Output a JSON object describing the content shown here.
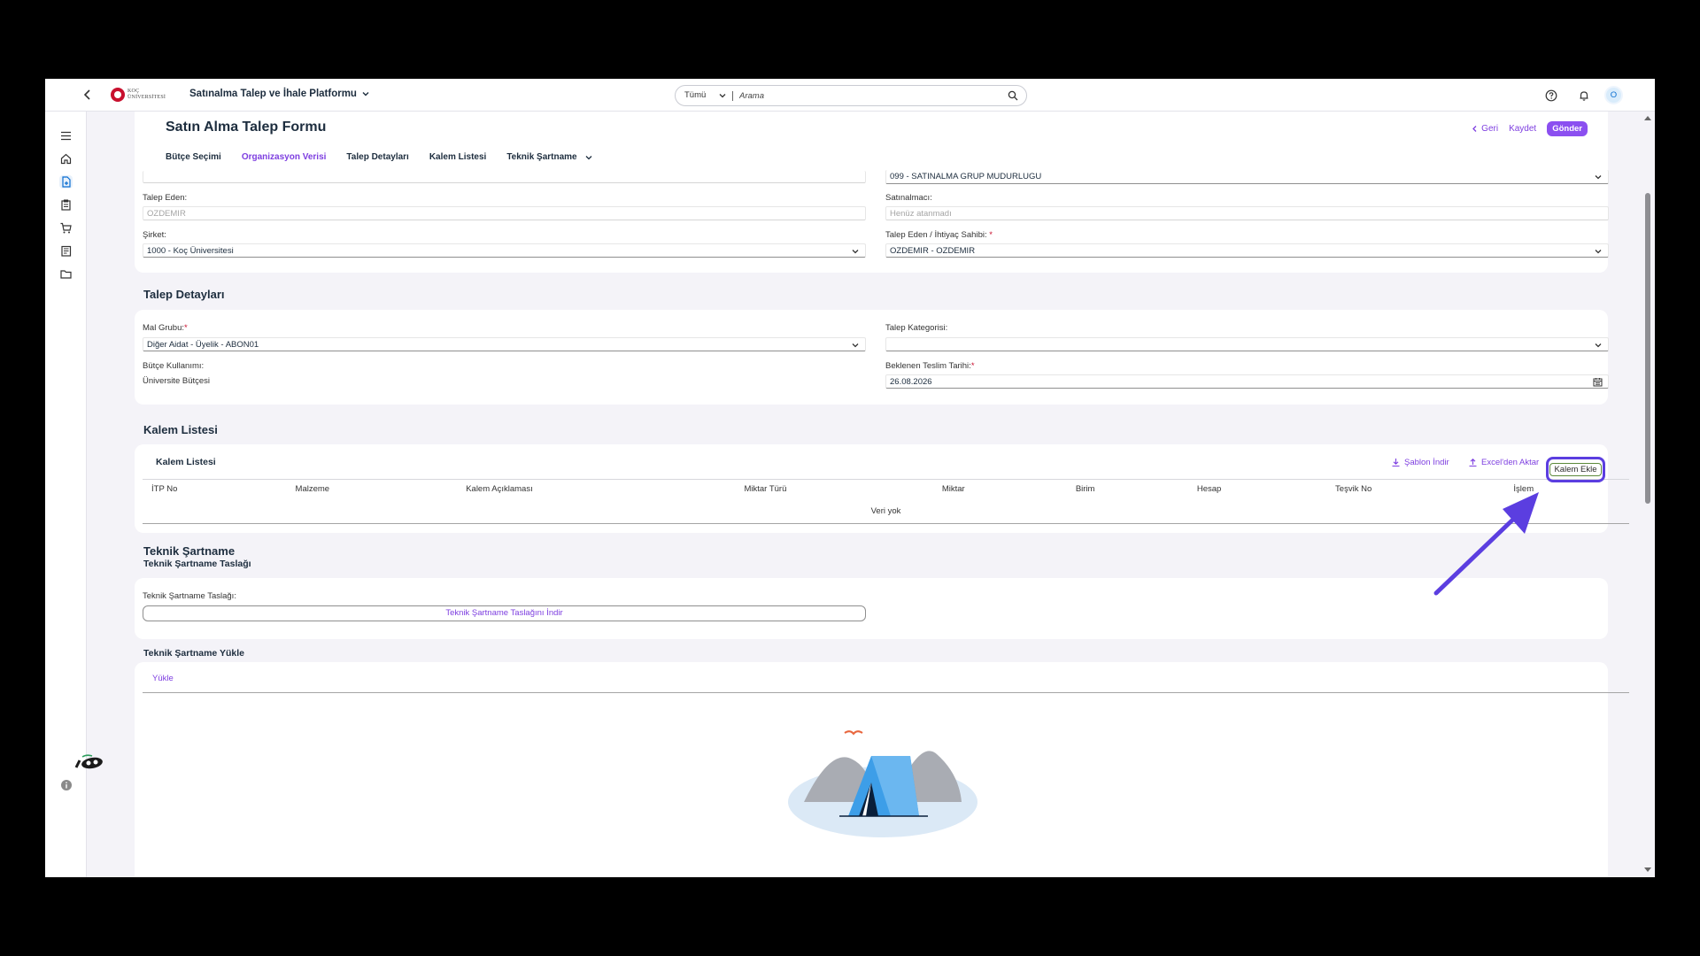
{
  "shell": {
    "product": "Satınalma Talep ve İhale Platformu",
    "search_scope": "Tümü",
    "search_placeholder": "Arama",
    "avatar": "O",
    "logo_line1": "KOÇ",
    "logo_line2": "ÜNİVERSİTESİ"
  },
  "page": {
    "title": "Satın Alma Talep Formu",
    "back_label": "Geri",
    "save_label": "Kaydet",
    "send_label": "Gönder"
  },
  "tabs": [
    {
      "label": "Bütçe Seçimi"
    },
    {
      "label": "Organizasyon Verisi"
    },
    {
      "label": "Talep Detayları"
    },
    {
      "label": "Kalem Listesi"
    },
    {
      "label": "Teknik Şartname"
    }
  ],
  "org": {
    "group_value": "099 - SATINALMA GRUP MUDURLUGU",
    "requester_label": "Talep Eden:",
    "requester_value": "OZDEMIR",
    "buyer_label": "Satınalmacı:",
    "buyer_placeholder": "Henüz atanmadı",
    "company_label": "Şirket:",
    "company_value": "1000 - Koç Üniversitesi",
    "owner_label": "Talep Eden / İhtiyaç Sahibi:",
    "owner_value": "OZDEMIR - OZDEMIR"
  },
  "details": {
    "title": "Talep Detayları",
    "material_group_label": "Mal Grubu:",
    "material_group_value": "Diğer Aidat - Üyelik - ABON01",
    "category_label": "Talep Kategorisi:",
    "category_value": "",
    "budget_usage_label": "Bütçe Kullanımı:",
    "budget_usage_value": "Üniversite Bütçesi",
    "delivery_label": "Beklenen Teslim Tarihi:",
    "delivery_value": "26.08.2026"
  },
  "items": {
    "title": "Kalem Listesi",
    "table_title": "Kalem Listesi",
    "template_download": "Şablon İndir",
    "excel_import": "Excel'den Aktar",
    "add_item": "Kalem Ekle",
    "columns": [
      "İTP No",
      "Malzeme",
      "Kalem Açıklaması",
      "Miktar Türü",
      "Miktar",
      "Birim",
      "Hesap",
      "Teşvik No",
      "İşlem"
    ],
    "empty_text": "Veri yok"
  },
  "spec": {
    "title": "Teknik Şartname",
    "draft_subtitle": "Teknik Şartname Taslağı",
    "draft_label": "Teknik Şartname Taslağı:",
    "draft_button": "Teknik Şartname Taslağını İndir",
    "upload_subtitle": "Teknik Şartname Yükle",
    "upload_tab": "Yükle"
  },
  "colors": {
    "accent": "#7e3fe0",
    "annotation": "#5b3ee0"
  }
}
